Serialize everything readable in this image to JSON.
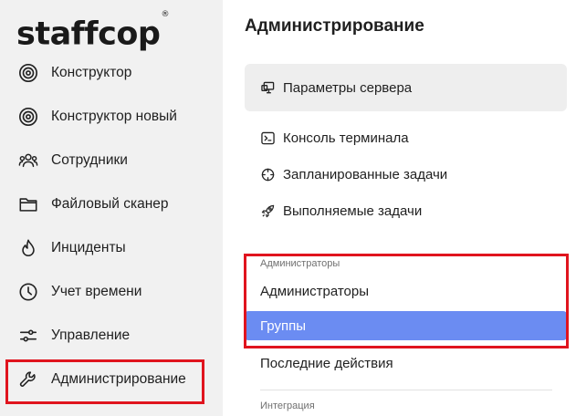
{
  "brand": {
    "name": "staffcop",
    "mark": "®"
  },
  "sidebar": {
    "items": [
      {
        "label": "Конструктор",
        "icon": "target-icon"
      },
      {
        "label": "Конструктор новый",
        "icon": "target-icon"
      },
      {
        "label": "Сотрудники",
        "icon": "people-icon"
      },
      {
        "label": "Файловый сканер",
        "icon": "folder-icon"
      },
      {
        "label": "Инциденты",
        "icon": "flame-icon"
      },
      {
        "label": "Учет времени",
        "icon": "clock-icon"
      },
      {
        "label": "Управление",
        "icon": "sliders-icon"
      },
      {
        "label": "Администрирование",
        "icon": "wrench-icon"
      }
    ],
    "active_index": 7
  },
  "main": {
    "title": "Администрирование",
    "menu": [
      {
        "label": "Параметры сервера",
        "icon": "monitor-icon",
        "selected": true
      },
      {
        "label": "Консоль терминала",
        "icon": "terminal-icon"
      },
      {
        "label": "Запланированные задачи",
        "icon": "crosshair-icon"
      },
      {
        "label": "Выполняемые задачи",
        "icon": "rocket-icon"
      }
    ],
    "admins_section": {
      "caption": "Администраторы",
      "items": [
        {
          "label": "Администраторы"
        },
        {
          "label": "Группы",
          "active": true
        },
        {
          "label": "Последние действия"
        }
      ]
    },
    "integration_section": {
      "caption": "Интеграция"
    }
  },
  "colors": {
    "accent": "#6b8cf2",
    "highlight": "#e0141e",
    "sidebar_bg": "#f1f1f1"
  }
}
